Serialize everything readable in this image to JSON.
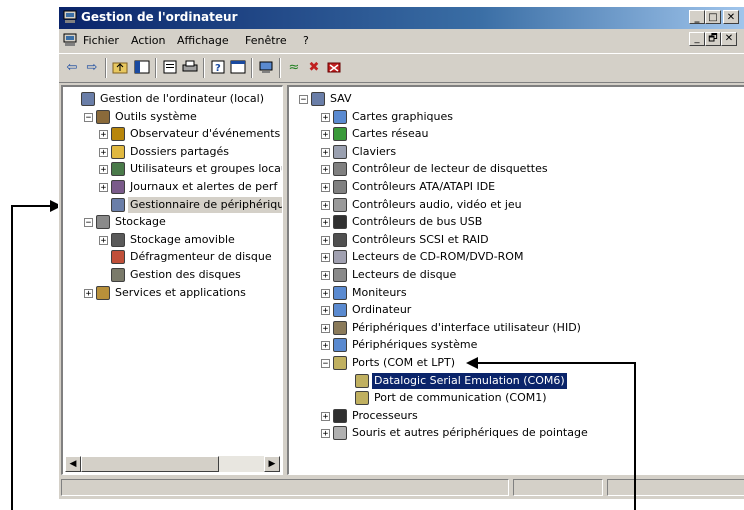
{
  "window": {
    "title": "Gestion de l'ordinateur",
    "controls": [
      "_",
      "□",
      "✕"
    ],
    "mdi_controls": [
      "_",
      "🗗",
      "✕"
    ]
  },
  "menu": [
    "Fichier",
    "Action",
    "Affichage",
    "Fenêtre",
    "?"
  ],
  "toolbar": {
    "icons": [
      "back-icon",
      "forward-icon",
      "up-folder-icon",
      "show-hide-tree-icon",
      "properties-icon",
      "print-icon",
      "help-icon",
      "view-icon",
      "scan-hardware-icon",
      "update-driver-icon",
      "uninstall-icon",
      "disable-icon"
    ]
  },
  "left_tree": [
    {
      "label": "Gestion de l'ordinateur (local)",
      "level": 0,
      "exp": "",
      "icon": "computer-icon",
      "color": "#6a7ea8"
    },
    {
      "label": "Outils système",
      "level": 1,
      "exp": "−",
      "icon": "tools-icon",
      "color": "#8a6a3a"
    },
    {
      "label": "Observateur d'événements",
      "level": 2,
      "exp": "+",
      "icon": "event-viewer-icon",
      "color": "#b8860b"
    },
    {
      "label": "Dossiers partagés",
      "level": 2,
      "exp": "+",
      "icon": "shared-folder-icon",
      "color": "#e0b840"
    },
    {
      "label": "Utilisateurs et groupes locau",
      "level": 2,
      "exp": "+",
      "icon": "users-icon",
      "color": "#4a7a4a"
    },
    {
      "label": "Journaux et alertes de perf",
      "level": 2,
      "exp": "+",
      "icon": "performance-icon",
      "color": "#7a5a8a"
    },
    {
      "label": "Gestionnaire de périphérique",
      "level": 2,
      "exp": "",
      "icon": "device-manager-icon",
      "color": "#6a7ea8",
      "selected": true
    },
    {
      "label": "Stockage",
      "level": 1,
      "exp": "−",
      "icon": "storage-icon",
      "color": "#8a8a8a"
    },
    {
      "label": "Stockage amovible",
      "level": 2,
      "exp": "+",
      "icon": "removable-storage-icon",
      "color": "#5a5a5a"
    },
    {
      "label": "Défragmenteur de disque",
      "level": 2,
      "exp": "",
      "icon": "defrag-icon",
      "color": "#c0503a"
    },
    {
      "label": "Gestion des disques",
      "level": 2,
      "exp": "",
      "icon": "disk-management-icon",
      "color": "#7a7a6a"
    },
    {
      "label": "Services et applications",
      "level": 1,
      "exp": "+",
      "icon": "services-icon",
      "color": "#b8903a"
    }
  ],
  "right_tree": [
    {
      "label": "SAV",
      "level": 0,
      "exp": "−",
      "icon": "computer-icon",
      "color": "#6a7ea8"
    },
    {
      "label": "Cartes graphiques",
      "level": 1,
      "exp": "+",
      "icon": "display-adapter-icon",
      "color": "#5a8ad0"
    },
    {
      "label": "Cartes réseau",
      "level": 1,
      "exp": "+",
      "icon": "network-card-icon",
      "color": "#3a9a3a"
    },
    {
      "label": "Claviers",
      "level": 1,
      "exp": "+",
      "icon": "keyboard-icon",
      "color": "#9aa0b0"
    },
    {
      "label": "Contrôleur de lecteur de disquettes",
      "level": 1,
      "exp": "+",
      "icon": "floppy-controller-icon",
      "color": "#808080"
    },
    {
      "label": "Contrôleurs ATA/ATAPI IDE",
      "level": 1,
      "exp": "+",
      "icon": "ide-controller-icon",
      "color": "#808080"
    },
    {
      "label": "Contrôleurs audio, vidéo et jeu",
      "level": 1,
      "exp": "+",
      "icon": "audio-icon",
      "color": "#9a9a9a"
    },
    {
      "label": "Contrôleurs de bus USB",
      "level": 1,
      "exp": "+",
      "icon": "usb-icon",
      "color": "#303030"
    },
    {
      "label": "Contrôleurs SCSI et RAID",
      "level": 1,
      "exp": "+",
      "icon": "scsi-icon",
      "color": "#505050"
    },
    {
      "label": "Lecteurs de CD-ROM/DVD-ROM",
      "level": 1,
      "exp": "+",
      "icon": "cdrom-icon",
      "color": "#a0a0b0"
    },
    {
      "label": "Lecteurs de disque",
      "level": 1,
      "exp": "+",
      "icon": "disk-drive-icon",
      "color": "#8a8a8a"
    },
    {
      "label": "Moniteurs",
      "level": 1,
      "exp": "+",
      "icon": "monitor-icon",
      "color": "#5a8ad0"
    },
    {
      "label": "Ordinateur",
      "level": 1,
      "exp": "+",
      "icon": "computer-icon",
      "color": "#5a8ad0"
    },
    {
      "label": "Périphériques d'interface utilisateur (HID)",
      "level": 1,
      "exp": "+",
      "icon": "hid-icon",
      "color": "#8a7a5a"
    },
    {
      "label": "Périphériques système",
      "level": 1,
      "exp": "+",
      "icon": "system-devices-icon",
      "color": "#5a8ad0"
    },
    {
      "label": "Ports (COM et LPT)",
      "level": 1,
      "exp": "−",
      "icon": "port-icon",
      "color": "#c0b060"
    },
    {
      "label": "Datalogic Serial Emulation (COM6)",
      "level": 2,
      "exp": "",
      "icon": "port-icon",
      "color": "#c0b060",
      "selected": true
    },
    {
      "label": "Port de communication (COM1)",
      "level": 2,
      "exp": "",
      "icon": "port-icon",
      "color": "#c0b060"
    },
    {
      "label": "Processeurs",
      "level": 1,
      "exp": "+",
      "icon": "processor-icon",
      "color": "#303030"
    },
    {
      "label": "Souris et autres périphériques de pointage",
      "level": 1,
      "exp": "+",
      "icon": "mouse-icon",
      "color": "#b0b0b0"
    }
  ],
  "colors": {
    "title_start": "#0a246a",
    "title_end": "#a6caf0",
    "face": "#d4d0c8",
    "selection": "#0a246a"
  }
}
